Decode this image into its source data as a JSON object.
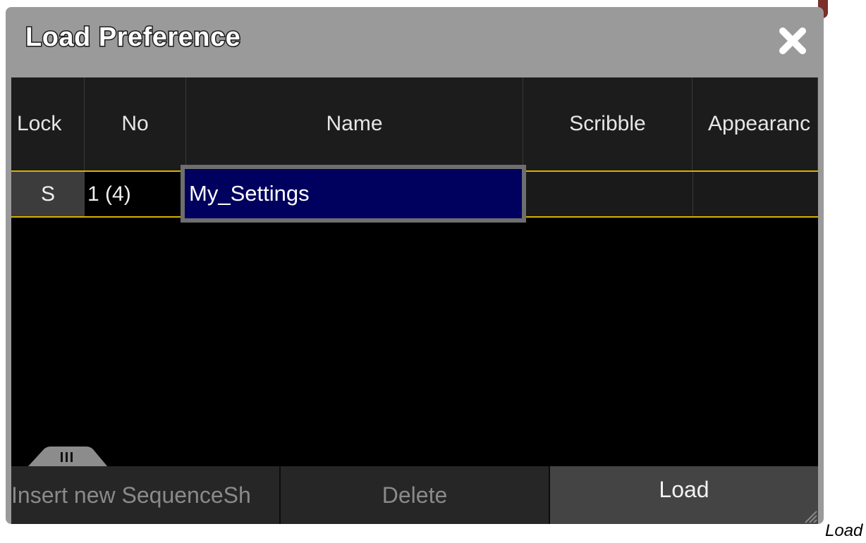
{
  "dialog": {
    "title": "Load Preference",
    "close_icon": "close-icon"
  },
  "table": {
    "columns": [
      "Lock",
      "No",
      "Name",
      "Scribble",
      "Appearanc"
    ],
    "rows": [
      {
        "lock": "S",
        "no": "1 (4)",
        "name": "My_Settings",
        "scribble": "",
        "appearance": ""
      }
    ],
    "row_line_color": "#d8b100",
    "edit_color": "#00005e"
  },
  "buttons": {
    "insert": "Insert new SequenceSh",
    "delete": "Delete",
    "load": "Load"
  },
  "caption": "Load"
}
